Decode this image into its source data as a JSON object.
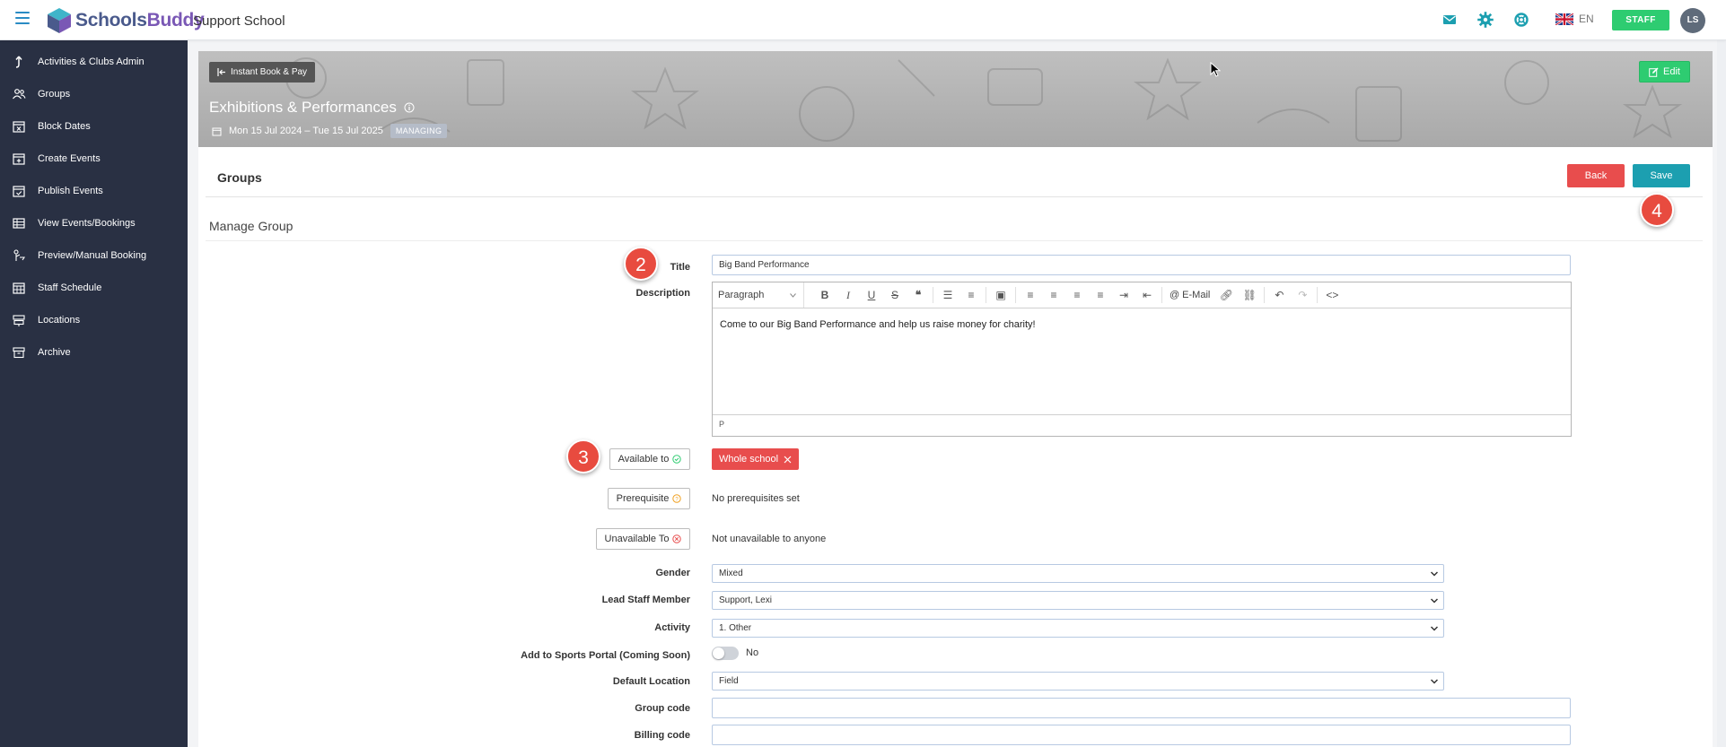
{
  "app": {
    "brand_part1": "Schools",
    "brand_part2": "Buddy",
    "school_name": "Support School",
    "language": "EN",
    "staff_label": "STAFF",
    "avatar_initials": "LS"
  },
  "sidebar": {
    "items": [
      {
        "label": "Activities & Clubs Admin",
        "icon": "arrow-up-icon"
      },
      {
        "label": "Groups",
        "icon": "users-icon"
      },
      {
        "label": "Block Dates",
        "icon": "calendar-x-icon"
      },
      {
        "label": "Create Events",
        "icon": "calendar-plus-icon"
      },
      {
        "label": "Publish Events",
        "icon": "calendar-check-icon"
      },
      {
        "label": "View Events/Bookings",
        "icon": "table-icon"
      },
      {
        "label": "Preview/Manual Booking",
        "icon": "person-pointer-icon"
      },
      {
        "label": "Staff Schedule",
        "icon": "calendar-grid-icon"
      },
      {
        "label": "Locations",
        "icon": "sign-icon"
      },
      {
        "label": "Archive",
        "icon": "archive-icon"
      }
    ]
  },
  "banner": {
    "back_link": "Instant Book & Pay",
    "edit_label": "Edit",
    "title": "Exhibitions & Performances",
    "dates": "Mon 15 Jul 2024 – Tue 15 Jul 2025",
    "status_badge": "MANAGING"
  },
  "panel": {
    "title": "Groups",
    "back_label": "Back",
    "save_label": "Save",
    "section_title": "Manage Group"
  },
  "annotations": {
    "step2": "2",
    "step3": "3",
    "step4": "4"
  },
  "form": {
    "title_label": "Title",
    "title_value": "Big Band Performance",
    "description_label": "Description",
    "editor": {
      "format": "Paragraph",
      "email_label": "E-Mail",
      "body": "Come to our Big Band Performance and help us raise money for charity!",
      "status_path": "P"
    },
    "available_to_label": "Available to",
    "available_to_value": "Whole school",
    "prerequisite_label": "Prerequisite",
    "prerequisite_value": "No prerequisites set",
    "unavailable_label": "Unavailable To",
    "unavailable_value": "Not unavailable to anyone",
    "gender_label": "Gender",
    "gender_value": "Mixed",
    "lead_staff_label": "Lead Staff Member",
    "lead_staff_value": "Support, Lexi",
    "activity_label": "Activity",
    "activity_value": "1. Other",
    "sports_portal_label": "Add to Sports Portal (Coming Soon)",
    "sports_portal_value": "No",
    "default_location_label": "Default Location",
    "default_location_value": "Field",
    "group_code_label": "Group code",
    "group_code_value": "",
    "billing_code_label": "Billing code",
    "billing_code_value": ""
  },
  "colors": {
    "sidebar_bg": "#293043",
    "accent_teal": "#1c9fb0",
    "danger_red": "#e84d4d",
    "success_green": "#2ecc71"
  }
}
